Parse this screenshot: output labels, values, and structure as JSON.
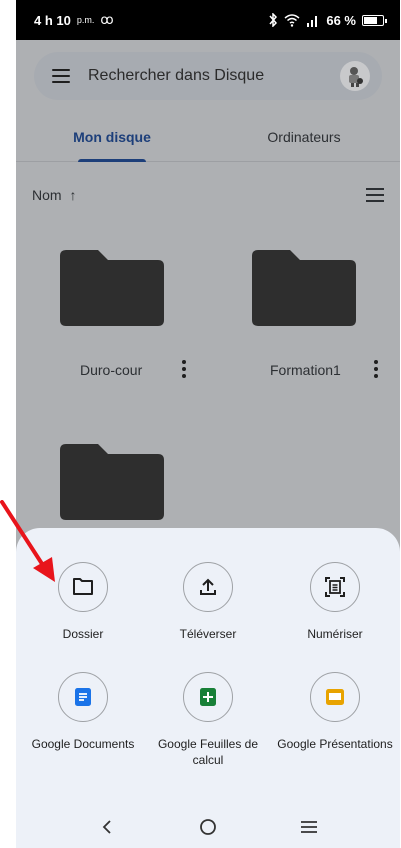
{
  "status_bar": {
    "time": "4 h 10",
    "ampm": "p.m.",
    "voicemail_symbol": "ꝏ",
    "battery_percent": "66 %",
    "battery_level": 0.66
  },
  "search": {
    "placeholder": "Rechercher dans Disque"
  },
  "tabs": [
    {
      "label": "Mon disque",
      "active": true
    },
    {
      "label": "Ordinateurs",
      "active": false
    }
  ],
  "sort": {
    "label": "Nom",
    "direction_symbol": "↑"
  },
  "folders": [
    {
      "name": "Duro-cour"
    },
    {
      "name": "Formation1"
    },
    {
      "name": ""
    }
  ],
  "sheet": {
    "actions": [
      {
        "label": "Dossier",
        "icon": "folder-icon"
      },
      {
        "label": "Téléverser",
        "icon": "upload-icon"
      },
      {
        "label": "Numériser",
        "icon": "scan-icon"
      },
      {
        "label": "Google Documents",
        "icon": "google-docs-icon",
        "color": "#1a73e8"
      },
      {
        "label": "Google Feuilles de calcul",
        "icon": "google-sheets-icon",
        "color": "#188038"
      },
      {
        "label": "Google Présentations",
        "icon": "google-slides-icon",
        "color": "#e8a300"
      }
    ]
  },
  "navbar": {
    "back_symbol": "<",
    "home_symbol": "○",
    "recents_symbol": "≡"
  },
  "colors": {
    "annotation_arrow": "#e8141b",
    "active_tab": "#1d3f7a"
  }
}
